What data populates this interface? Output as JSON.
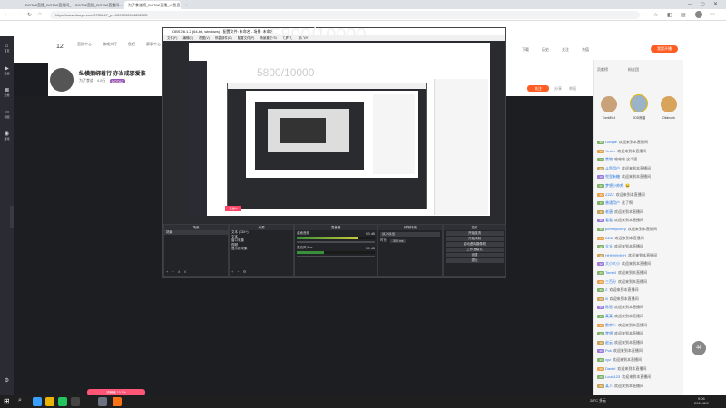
{
  "browser": {
    "tabs": [
      {
        "label": "DOTA2直播_DOTA2直播间_一战到底在斗鱼看"
      },
      {
        "label": "DOTA2直播_DOTA2直播间..."
      },
      {
        "label": "为了食道酱_DOTA2直播_斗鱼直播"
      }
    ],
    "url": "https://www.douyu.com/9750247_p=-1597098954302025",
    "new_tab": "+"
  },
  "leftnav": {
    "items": [
      {
        "label": "首页"
      },
      {
        "label": "直播"
      },
      {
        "label": "分类"
      },
      {
        "label": "视频"
      },
      {
        "label": "游戏"
      }
    ]
  },
  "header": {
    "level_num": "12",
    "menu_items": [
      {
        "label": "直播中心"
      },
      {
        "label": "游戏大厅"
      },
      {
        "label": "鱼吧"
      },
      {
        "label": "赛事中心"
      },
      {
        "label": "斗鱼体育"
      }
    ],
    "right_items": [
      {
        "label": "下载"
      },
      {
        "label": "历史"
      },
      {
        "label": "关注"
      },
      {
        "label": "充值"
      },
      {
        "label": "开播"
      }
    ],
    "open_stream_btn": "我要开播"
  },
  "streamer": {
    "title": "纵横捆绑着行 亦当戒邪爱谁",
    "name": "为了食道",
    "fans": "4.8万",
    "category": "DOTA2",
    "follow_btn": "关注",
    "share_btn": "分享",
    "report_btn": "举报"
  },
  "overlay_text": "5800/10000",
  "obs": {
    "title": "OBS 26.1.2 (64-bit, windows) - 配置文件: 未命名 - 场景: 未命名",
    "menu": [
      "文件(F)",
      "编辑(E)",
      "视图(V)",
      "停靠部件(D)",
      "配置文件(P)",
      "场景集合(S)",
      "工具(T)",
      "帮助(H)"
    ],
    "docks": {
      "scenes": {
        "title": "场景",
        "items": [
          "场景"
        ]
      },
      "sources": {
        "title": "来源",
        "items": [
          "文本 (GDI+)",
          "文本",
          "窗口采集",
          "视频",
          "显示器采集"
        ]
      },
      "mixer": {
        "title": "混音器",
        "tracks": [
          {
            "name": "桌面音频",
            "level": "0.0 dB",
            "fill": 0.78
          },
          {
            "name": "麦克风/Aux",
            "level": "0.0 dB",
            "fill": 0.35
          }
        ]
      },
      "transitions": {
        "title": "转场特效",
        "type": "淡入淡出",
        "duration_label": "时长",
        "duration": "300 ms"
      },
      "controls": {
        "title": "控件",
        "buttons": [
          "开始推流",
          "开始录制",
          "启动虚拟摄像机",
          "工作室模式",
          "设置",
          "退出"
        ]
      }
    },
    "preview_label": "直播中"
  },
  "chat": {
    "gift_header": "贡献榜",
    "rank_header": "粉丝团",
    "top_users": [
      {
        "name": "TomMM4"
      },
      {
        "name": "DDD熊猫"
      },
      {
        "name": "Oldmonk"
      }
    ],
    "messages": [
      {
        "level": "40",
        "user": "Google",
        "text": "欢迎来到本直播间"
      },
      {
        "level": "30",
        "user": "Yester",
        "text": "欢迎来到本直播间"
      },
      {
        "level": "12",
        "user": "食物",
        "text": "哈哈哈 这个逼"
      },
      {
        "level": "20",
        "user": "斗鱼用户",
        "text": "欢迎来到本直播间"
      },
      {
        "level": "10",
        "user": "兜里有糖",
        "text": "欢迎来到本直播间"
      },
      {
        "level": "21",
        "user": "梦想小帅帅",
        "text": "😀"
      },
      {
        "level": "15",
        "user": "ZZZZ",
        "text": "欢迎来到本直播间"
      },
      {
        "level": "8",
        "user": "普通用户",
        "text": "这了啊"
      },
      {
        "level": "11",
        "user": "老唐",
        "text": "欢迎来到本直播间"
      },
      {
        "level": "30",
        "user": "看看",
        "text": "欢迎来到本直播间"
      },
      {
        "level": "30",
        "user": "pommycorey",
        "text": "欢迎来到本直播间"
      },
      {
        "level": "24",
        "user": "DDD",
        "text": "欢迎来到本直播间"
      },
      {
        "level": "12",
        "user": "大头",
        "text": "欢迎来到本直播间"
      },
      {
        "level": "10",
        "user": "HHHHHHHH",
        "text": "欢迎来到本直播间"
      },
      {
        "level": "12",
        "user": "大小大小",
        "text": "欢迎来到本直播间"
      },
      {
        "level": "20",
        "user": "Tom04",
        "text": "欢迎来到本直播间"
      },
      {
        "level": "20",
        "user": "三百分",
        "text": "欢迎来到本直播间"
      },
      {
        "level": "30",
        "user": "Z",
        "text": "欢迎来到本直播间"
      },
      {
        "level": "20",
        "user": "lll",
        "text": "欢迎来到本直播间"
      },
      {
        "level": "30",
        "user": "陈智",
        "text": "欢迎来到本直播间"
      },
      {
        "level": "12",
        "user": "某某",
        "text": "欢迎来到本直播间"
      },
      {
        "level": "30",
        "user": "数字人",
        "text": "欢迎来到本直播间"
      },
      {
        "level": "12",
        "user": "梦想",
        "text": "欢迎来到本直播间"
      },
      {
        "level": "12",
        "user": "赵云",
        "text": "欢迎来到本直播间"
      },
      {
        "level": "30",
        "user": "Pok",
        "text": "欢迎来到本直播间"
      },
      {
        "level": "30",
        "user": "xyz",
        "text": "欢迎来到本直播间"
      },
      {
        "level": "30",
        "user": "Daniel",
        "text": "欢迎来到本直播间"
      },
      {
        "level": "25",
        "user": "Louis123",
        "text": "欢迎来到本直播间"
      },
      {
        "level": "20",
        "user": "某人",
        "text": "欢迎来到本直播间"
      }
    ],
    "speed_badge": "44"
  },
  "taskbar": {
    "time": "9:06",
    "date": "2021/8/3",
    "weather": "28°C 多云",
    "popup": "流畅度 10.1%"
  },
  "colors": {
    "accent": "#ff5d23",
    "chat_name": "#2b78e4",
    "obs_bg": "#2a2b2f"
  }
}
